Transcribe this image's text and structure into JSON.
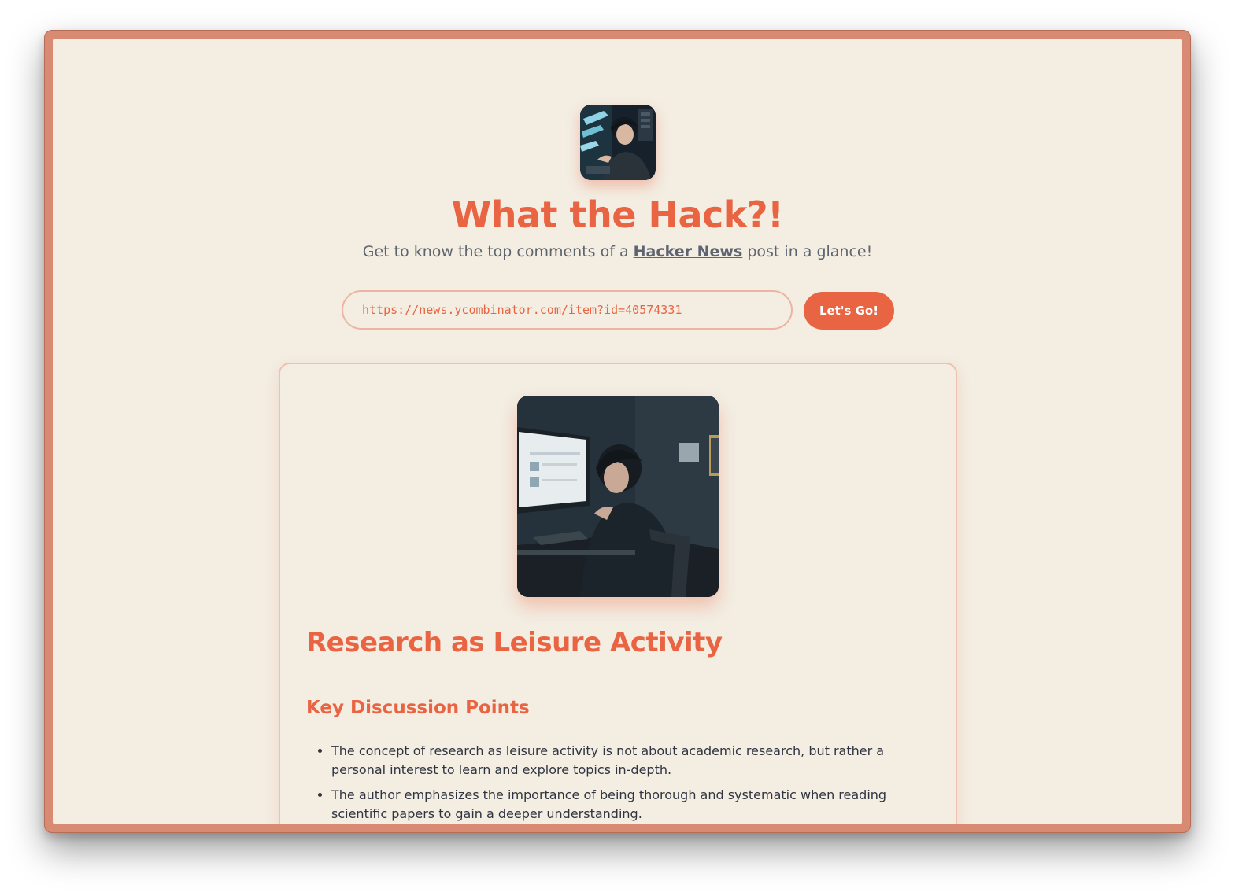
{
  "app": {
    "title": "What the Hack?!",
    "tagline_before": "Get to know the top comments of a ",
    "tagline_link": "Hacker News",
    "tagline_after": " post in a glance!"
  },
  "search": {
    "value": "https://news.ycombinator.com/item?id=40574331",
    "button_label": "Let's Go!"
  },
  "result": {
    "title": "Research as Leisure Activity",
    "section_heading": "Key Discussion Points",
    "points": [
      "The concept of research as leisure activity is not about academic research, but rather a personal interest to learn and explore topics in-depth.",
      "The author emphasizes the importance of being thorough and systematic when reading scientific papers to gain a deeper understanding."
    ]
  },
  "colors": {
    "accent": "#e96442",
    "background": "#f3ede2",
    "frame": "#d98a73",
    "text_muted": "#5d6470",
    "text_body": "#2f3440"
  },
  "icons": {
    "logo": "hacker-portrait-image",
    "post_image": "person-at-computer-image"
  }
}
